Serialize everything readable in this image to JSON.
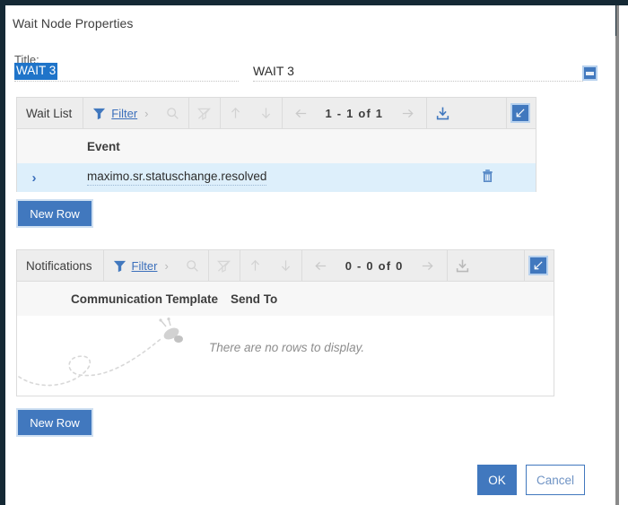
{
  "dialog": {
    "title": "Wait Node Properties"
  },
  "title_field": {
    "label": "Title:",
    "value": "WAIT 3",
    "secondary_value": "WAIT 3",
    "detail_menu_icon": "detail-menu-icon"
  },
  "wait_list": {
    "name": "Wait List",
    "filter_label": "Filter",
    "filter_icon": "filter-icon",
    "chevron_icon": "chevron-right-icon",
    "search_icon": "search-icon",
    "clear_filter_icon": "clear-filter-icon",
    "move_up_icon": "arrow-up-icon",
    "move_down_icon": "arrow-down-icon",
    "prev_icon": "arrow-left-icon",
    "next_icon": "arrow-right-icon",
    "pager_text": "1 - 1 of 1",
    "download_icon": "download-icon",
    "collapse_icon": "collapse-icon",
    "columns": [
      "Event"
    ],
    "rows": [
      {
        "expand_icon": "chevron-right-icon",
        "event": "maximo.sr.statuschange.resolved",
        "delete_icon": "trash-icon"
      }
    ],
    "new_row_label": "New Row"
  },
  "notifications": {
    "name": "Notifications",
    "filter_label": "Filter",
    "filter_icon": "filter-icon",
    "chevron_icon": "chevron-right-icon",
    "search_icon": "search-icon",
    "clear_filter_icon": "clear-filter-icon",
    "move_up_icon": "arrow-up-icon",
    "move_down_icon": "arrow-down-icon",
    "prev_icon": "arrow-left-icon",
    "next_icon": "arrow-right-icon",
    "pager_text": "0 - 0 of 0",
    "download_icon": "download-icon",
    "collapse_icon": "collapse-icon",
    "columns": [
      "Communication Template",
      "Send To"
    ],
    "empty_message": "There are no rows to display.",
    "empty_art_icon": "bee-illustration",
    "new_row_label": "New Row"
  },
  "footer": {
    "ok_label": "OK",
    "cancel_label": "Cancel"
  },
  "colors": {
    "accent_blue": "#4178be",
    "link_blue": "#3b6fbb",
    "selected_row": "#ddeffb",
    "toolbar_gray": "#ededed",
    "chrome_dark": "#152935",
    "highlight_blue": "#1f74c9"
  }
}
